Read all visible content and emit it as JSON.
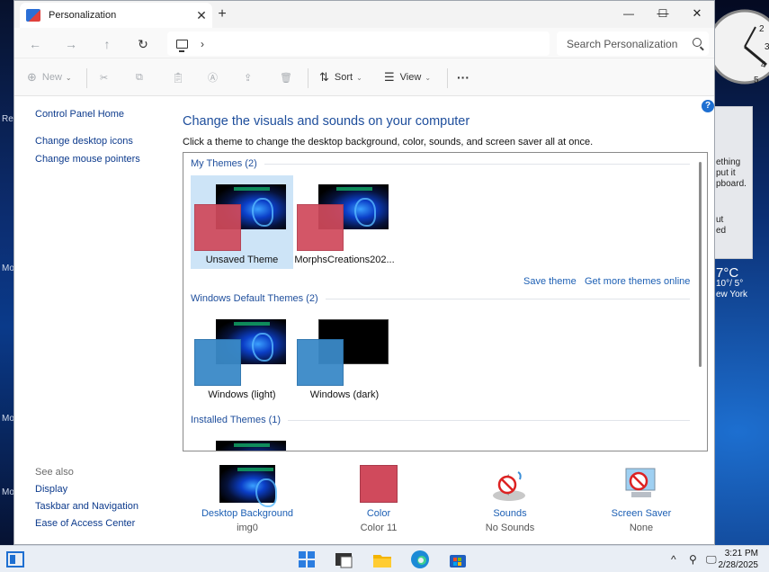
{
  "window": {
    "tab_title": "Personalization",
    "search_placeholder": "Search Personalization"
  },
  "toolbar": {
    "new_label": "New",
    "sort_label": "Sort",
    "view_label": "View",
    "more_label": "···"
  },
  "sidebar": {
    "links": [
      "Control Panel Home",
      "Change desktop icons",
      "Change mouse pointers"
    ],
    "see_also_label": "See also",
    "see_also_links": [
      "Display",
      "Taskbar and Navigation",
      "Ease of Access Center"
    ]
  },
  "main": {
    "title": "Change the visuals and sounds on your computer",
    "subtitle": "Click a theme to change the desktop background, color, sounds, and screen saver all at once.",
    "groups": [
      {
        "header": "My Themes (2)"
      },
      {
        "header": "Windows Default Themes (2)"
      },
      {
        "header": "Installed Themes (1)"
      }
    ],
    "themes": [
      {
        "label": "Unsaved Theme",
        "selected": true
      },
      {
        "label": "MorphsCreations202...",
        "selected": false
      },
      {
        "label": "Windows (light)",
        "selected": false
      },
      {
        "label": "Windows (dark)",
        "selected": false
      }
    ],
    "save_theme": "Save theme",
    "get_more": "Get more themes online"
  },
  "bottom": [
    {
      "label": "Desktop Background",
      "value": "img0"
    },
    {
      "label": "Color",
      "value": "Color 11"
    },
    {
      "label": "Sounds",
      "value": "No Sounds"
    },
    {
      "label": "Screen Saver",
      "value": "None"
    }
  ],
  "desktop": {
    "left_labels": [
      "Re",
      "Mo",
      "Mo",
      "Mo"
    ],
    "sticky_lines": [
      "ething",
      "put it",
      "pboard.",
      "",
      "",
      "ut",
      "ed"
    ],
    "weather_temp": "7°C",
    "weather_range": "10°/ 5°",
    "weather_city": "ew York",
    "clock_gadget_numbers": [
      "2",
      "3",
      "4",
      "5"
    ]
  },
  "taskbar": {
    "time": "3:21 PM",
    "date": "2/28/2025",
    "tray_chevron": "^"
  },
  "colors": {
    "accent_blue": "#1e4e9c",
    "link_blue": "#1c5fb4",
    "selected_bg": "#cde4f7",
    "theme_red": "#d04a5c",
    "theme_blue": "#3a8ac8"
  }
}
